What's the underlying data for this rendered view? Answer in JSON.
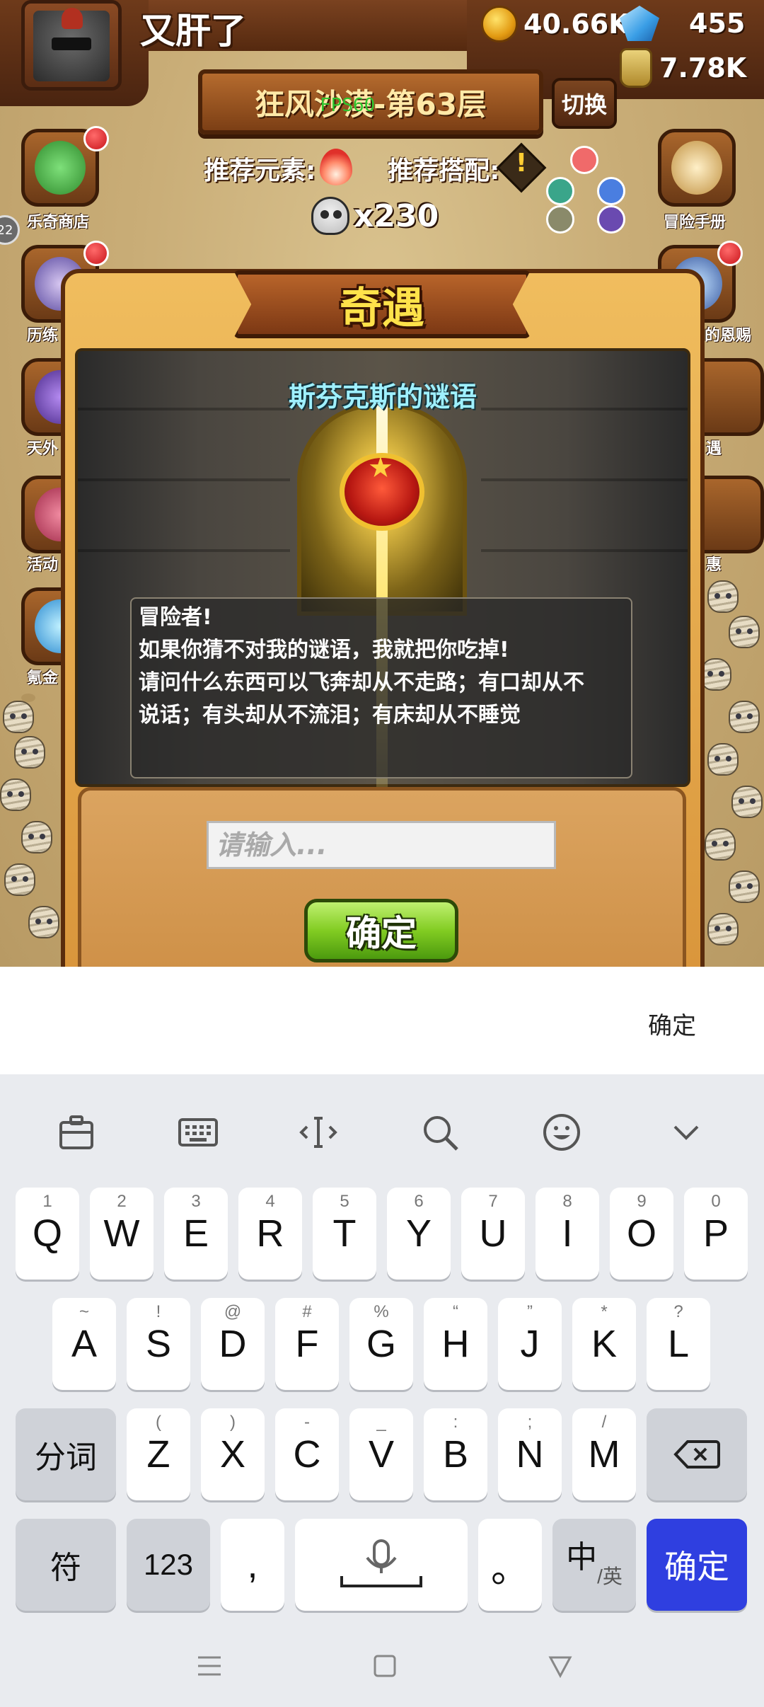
{
  "game": {
    "player_name": "又肝了",
    "gold": "40.66K",
    "gems": "455",
    "potion": "7.78K",
    "level_banner": "狂风沙漠-第63层",
    "fps": "FPS60",
    "switch_label": "切换",
    "recommend_element_label": "推荐元素:",
    "recommend_combo_label": "推荐搭配:",
    "enemy_count": "x230",
    "side_left": [
      {
        "label": "乐奇商店"
      },
      {
        "label": "历练"
      },
      {
        "label": "天外"
      },
      {
        "label": "活动"
      },
      {
        "label": "氪金"
      }
    ],
    "side_right": [
      {
        "label": "冒险手册"
      },
      {
        "label": "的恩赐"
      },
      {
        "label": "遇"
      },
      {
        "label": "惠"
      }
    ],
    "side_badge": "22"
  },
  "modal": {
    "title": "奇遇",
    "riddle_title": "斯芬克斯的谜语",
    "riddle_lines": [
      "冒险者!",
      "如果你猜不对我的谜语，我就把你吃掉!",
      "请问什么东西可以飞奔却从不走路；有口却从不",
      "说话；有头却从不流泪；有床却从不睡觉"
    ],
    "input_placeholder": "请输入...",
    "confirm_label": "确定"
  },
  "ime": {
    "confirm_label": "确定"
  },
  "keyboard": {
    "toolbar_icons": [
      "clipboard-icon",
      "keyboard-icon",
      "cursor-icon",
      "search-icon",
      "emoji-icon",
      "collapse-icon"
    ],
    "row1": [
      {
        "key": "Q",
        "hint": "1"
      },
      {
        "key": "W",
        "hint": "2"
      },
      {
        "key": "E",
        "hint": "3"
      },
      {
        "key": "R",
        "hint": "4"
      },
      {
        "key": "T",
        "hint": "5"
      },
      {
        "key": "Y",
        "hint": "6"
      },
      {
        "key": "U",
        "hint": "7"
      },
      {
        "key": "I",
        "hint": "8"
      },
      {
        "key": "O",
        "hint": "9"
      },
      {
        "key": "P",
        "hint": "0"
      }
    ],
    "row2": [
      {
        "key": "A",
        "hint": "~"
      },
      {
        "key": "S",
        "hint": "!"
      },
      {
        "key": "D",
        "hint": "@"
      },
      {
        "key": "F",
        "hint": "#"
      },
      {
        "key": "G",
        "hint": "%"
      },
      {
        "key": "H",
        "hint": "“"
      },
      {
        "key": "J",
        "hint": "”"
      },
      {
        "key": "K",
        "hint": "*"
      },
      {
        "key": "L",
        "hint": "?"
      }
    ],
    "row3": [
      {
        "key": "Z",
        "hint": "("
      },
      {
        "key": "X",
        "hint": ")"
      },
      {
        "key": "C",
        "hint": "-"
      },
      {
        "key": "V",
        "hint": "_"
      },
      {
        "key": "B",
        "hint": ":"
      },
      {
        "key": "N",
        "hint": ";"
      },
      {
        "key": "M",
        "hint": "/"
      }
    ],
    "segment_label": "分词",
    "symbol_label": "符",
    "numeric_label": "123",
    "comma": ",",
    "period": "。",
    "lang_main": "中",
    "lang_sub": "/英",
    "enter_label": "确定"
  }
}
